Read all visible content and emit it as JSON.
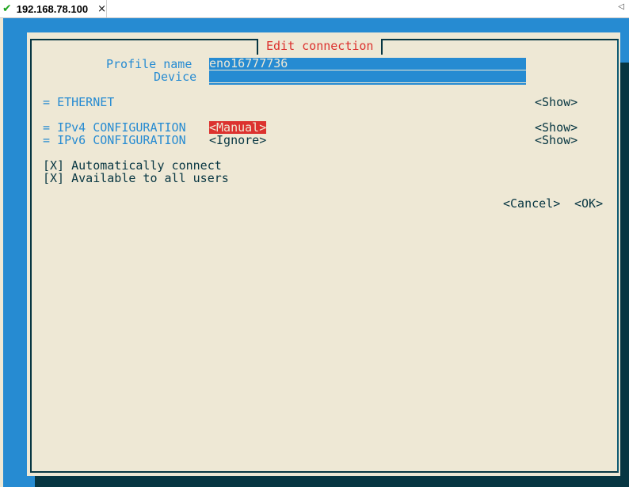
{
  "tab": {
    "status_icon": "check-icon",
    "title": "192.168.78.100",
    "close_glyph": "×"
  },
  "dialog": {
    "title": "Edit connection",
    "profile_name_label": "Profile name",
    "profile_name_value": "eno16777736",
    "device_label": "Device",
    "device_value": "",
    "ethernet": {
      "prefix": "=",
      "label": "ETHERNET",
      "toggle": "<Show>"
    },
    "ipv4": {
      "prefix": "=",
      "label": "IPv4 CONFIGURATION",
      "mode": "<Manual>",
      "toggle": "<Show>"
    },
    "ipv6": {
      "prefix": "=",
      "label": "IPv6 CONFIGURATION",
      "mode": "<Ignore>",
      "toggle": "<Show>"
    },
    "auto_connect": {
      "box": "[X]",
      "label": "Automatically connect",
      "checked": true
    },
    "all_users": {
      "box": "[X]",
      "label": "Available to all users",
      "checked": true
    },
    "cancel_label": "<Cancel>",
    "ok_label": "<OK>"
  },
  "colors": {
    "terminal_blue": "#268bd2",
    "dialog_bg": "#eee8d5",
    "shadow": "#073642",
    "title_red": "#dc322f",
    "focus_red": "#dc322f"
  }
}
